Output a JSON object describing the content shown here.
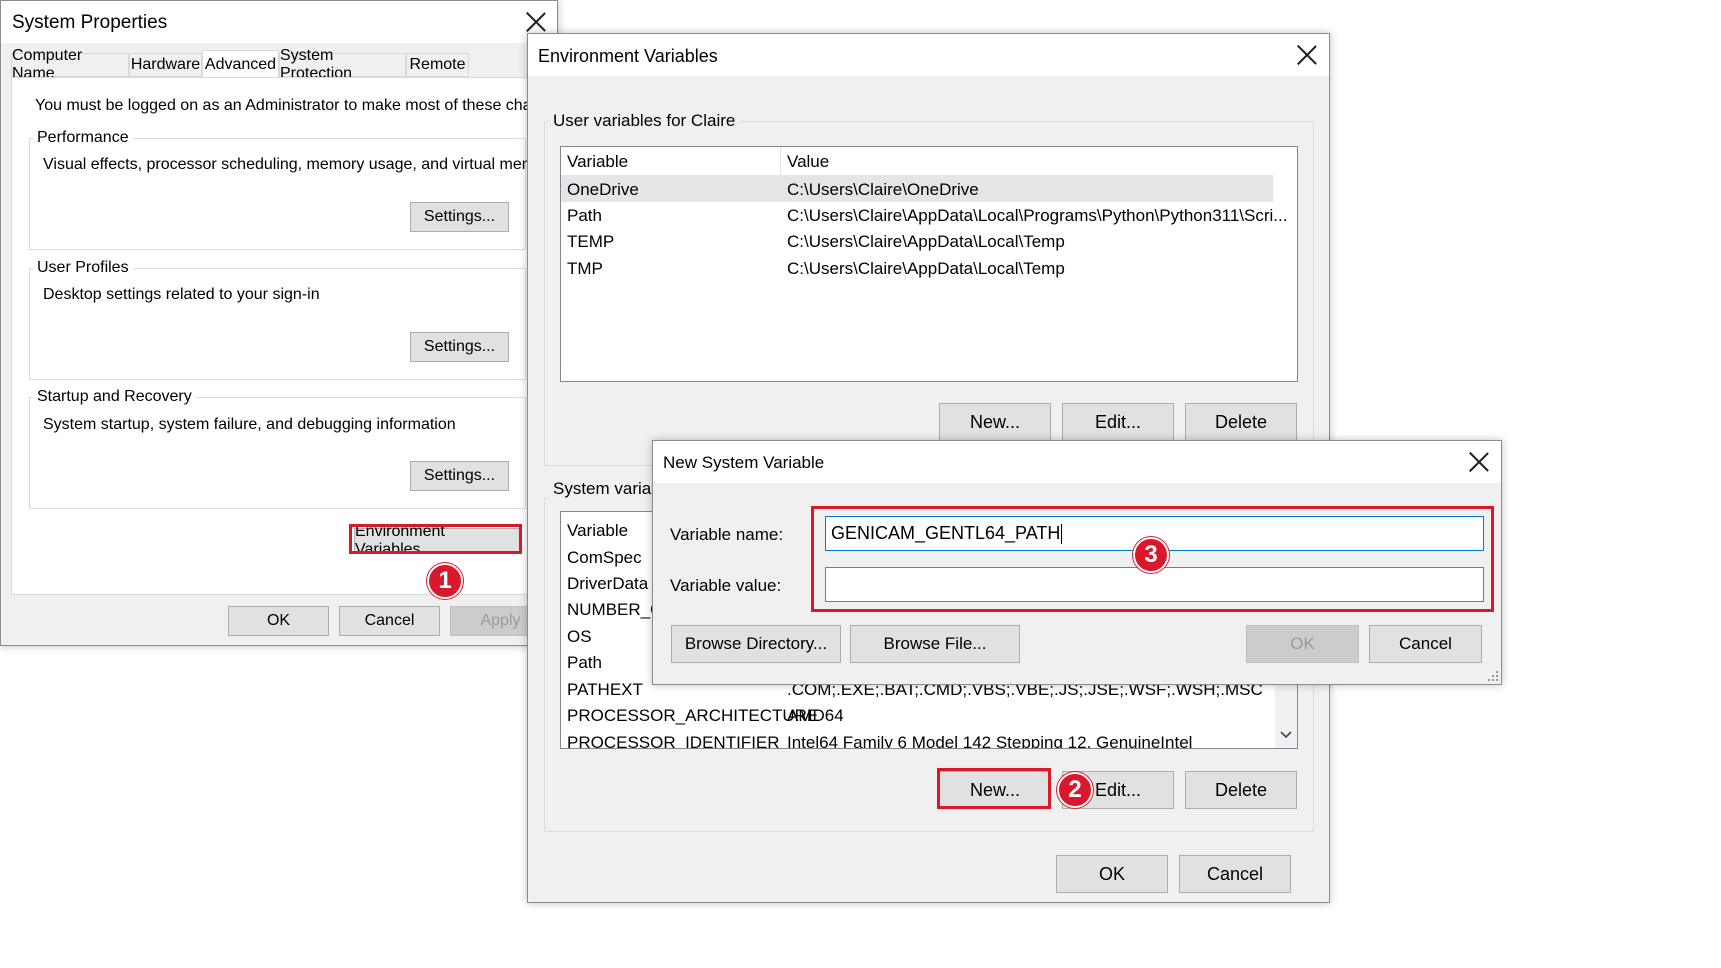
{
  "system_properties": {
    "title": "System Properties",
    "tabs": [
      "Computer Name",
      "Hardware",
      "Advanced",
      "System Protection",
      "Remote"
    ],
    "active_tab": "Advanced",
    "admin_note": "You must be logged on as an Administrator to make most of these changes.",
    "performance": {
      "label": "Performance",
      "desc": "Visual effects, processor scheduling, memory usage, and virtual memory",
      "button": "Settings..."
    },
    "user_profiles": {
      "label": "User Profiles",
      "desc": "Desktop settings related to your sign-in",
      "button": "Settings..."
    },
    "startup": {
      "label": "Startup and Recovery",
      "desc": "System startup, system failure, and debugging information",
      "button": "Settings..."
    },
    "env_button": "Environment Variables...",
    "ok": "OK",
    "cancel": "Cancel",
    "apply": "Apply"
  },
  "env_vars": {
    "title": "Environment Variables",
    "user_group": "User variables for Claire",
    "col_variable": "Variable",
    "col_value": "Value",
    "user_rows": [
      {
        "name": "OneDrive",
        "value": "C:\\Users\\Claire\\OneDrive"
      },
      {
        "name": "Path",
        "value": "C:\\Users\\Claire\\AppData\\Local\\Programs\\Python\\Python311\\Scri..."
      },
      {
        "name": "TEMP",
        "value": "C:\\Users\\Claire\\AppData\\Local\\Temp"
      },
      {
        "name": "TMP",
        "value": "C:\\Users\\Claire\\AppData\\Local\\Temp"
      }
    ],
    "system_group": "System variab",
    "system_rows": [
      {
        "name": "ComSpec",
        "value": ""
      },
      {
        "name": "DriverData",
        "value": ""
      },
      {
        "name": "NUMBER_O",
        "value": ""
      },
      {
        "name": "OS",
        "value": ""
      },
      {
        "name": "Path",
        "value": ""
      },
      {
        "name": "PATHEXT",
        "value": ".COM;.EXE;.BAT;.CMD;.VBS;.VBE;.JS;.JSE;.WSF;.WSH;.MSC"
      },
      {
        "name": "PROCESSOR_ARCHITECTURE",
        "value": "AMD64"
      },
      {
        "name": "PROCESSOR_IDENTIFIER",
        "value": "Intel64 Family 6 Model 142 Stepping 12, GenuineIntel"
      }
    ],
    "new": "New...",
    "edit": "Edit...",
    "delete": "Delete",
    "ok": "OK",
    "cancel": "Cancel"
  },
  "new_var": {
    "title": "New System Variable",
    "name_label": "Variable name:",
    "name_value": "GENICAM_GENTL64_PATH",
    "value_label": "Variable value:",
    "value_value": "",
    "browse_dir": "Browse Directory...",
    "browse_file": "Browse File...",
    "ok": "OK",
    "cancel": "Cancel"
  },
  "badges": {
    "one": "1",
    "two": "2",
    "three": "3"
  },
  "colors": {
    "highlight": "#d9182b",
    "selection": "#e5e5e5",
    "focus": "#0078d7"
  }
}
